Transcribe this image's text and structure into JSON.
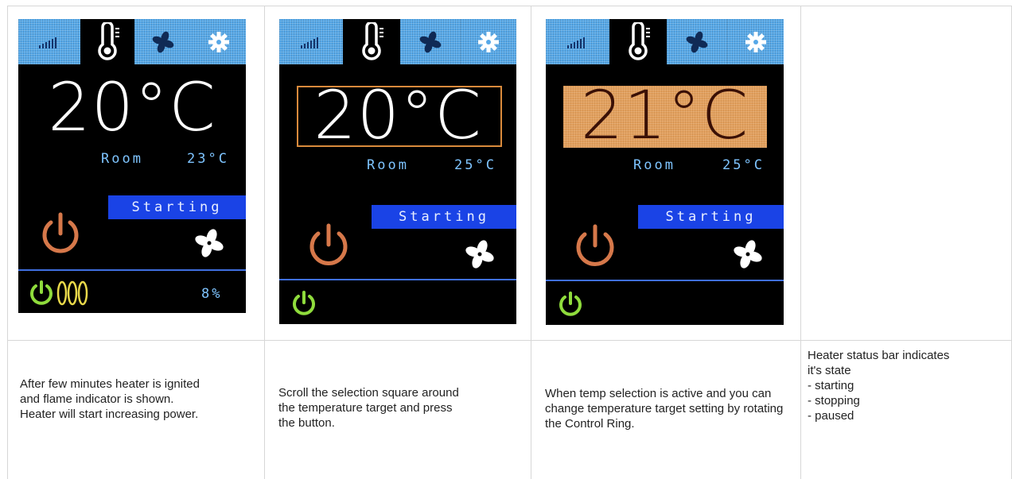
{
  "columns": [
    {
      "screen": {
        "setpoint": "20°C",
        "room_label": "Room",
        "room_temp": "23°C",
        "status": "Starting",
        "power_percent": "8%"
      },
      "description": [
        "After few minutes heater is ignited and flame indicator is shown.",
        "Heater will start increasing power."
      ]
    },
    {
      "screen": {
        "setpoint": "20°C",
        "room_label": "Room",
        "room_temp": "25°C",
        "status": "Starting"
      },
      "description": [
        "Scroll the selection square around the temperature target and press the button."
      ]
    },
    {
      "screen": {
        "setpoint": "21°C",
        "room_label": "Room",
        "room_temp": "25°C",
        "status": "Starting"
      },
      "description": [
        "When temp selection is active and you can change temperature target setting by rotating the Control Ring."
      ]
    },
    {
      "description": [
        "Heater status bar indicates it's state",
        "- starting",
        "- stopping",
        "- paused"
      ]
    }
  ],
  "icons": {
    "tab_signal": "signal-bars-icon",
    "tab_thermometer": "thermometer-icon",
    "tab_fan": "fan-icon",
    "tab_settings": "gear-icon",
    "power": "power-icon",
    "fan": "fan-icon",
    "flame": "flame-coils-icon"
  },
  "colors": {
    "tab_bg": "#56a8e8",
    "status_bar": "#1a43e6",
    "room_text": "#7ec4ff",
    "power_orange": "#d6784a",
    "power_green": "#8fdc3c",
    "flame_yellow": "#e8d84a",
    "selection_orange": "#e2a05e"
  }
}
